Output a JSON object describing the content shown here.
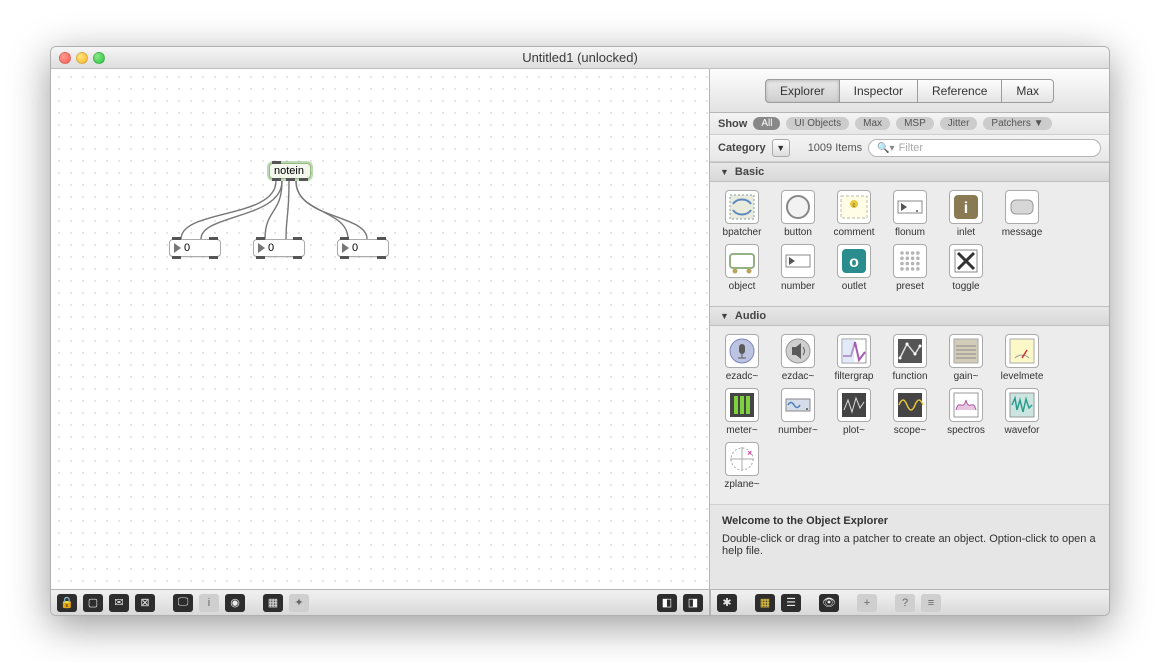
{
  "window": {
    "title": "Untitled1 (unlocked)"
  },
  "patcher": {
    "notein_label": "notein",
    "num1": "0",
    "num2": "0",
    "num3": "0"
  },
  "tabs": {
    "explorer": "Explorer",
    "inspector": "Inspector",
    "reference": "Reference",
    "max": "Max"
  },
  "filters": {
    "show_label": "Show",
    "all": "All",
    "ui_objects": "UI Objects",
    "max": "Max",
    "msp": "MSP",
    "jitter": "Jitter",
    "patchers": "Patchers ▼",
    "category_label": "Category",
    "item_count": "1009 Items",
    "search_placeholder": "Filter"
  },
  "sections": {
    "basic": "Basic",
    "audio": "Audio"
  },
  "basic_items": [
    {
      "name": "bpatcher",
      "icon": "bpatcher"
    },
    {
      "name": "button",
      "icon": "button"
    },
    {
      "name": "comment",
      "icon": "comment"
    },
    {
      "name": "flonum",
      "icon": "flonum"
    },
    {
      "name": "inlet",
      "icon": "inlet"
    },
    {
      "name": "message",
      "icon": "message"
    },
    {
      "name": "object",
      "icon": "object"
    },
    {
      "name": "number",
      "icon": "number"
    },
    {
      "name": "outlet",
      "icon": "outlet"
    },
    {
      "name": "preset",
      "icon": "preset"
    },
    {
      "name": "toggle",
      "icon": "toggle"
    }
  ],
  "audio_items": [
    {
      "name": "ezadc~",
      "icon": "ezadc"
    },
    {
      "name": "ezdac~",
      "icon": "ezdac"
    },
    {
      "name": "filtergrap",
      "icon": "filtergraph"
    },
    {
      "name": "function",
      "icon": "function"
    },
    {
      "name": "gain~",
      "icon": "gain"
    },
    {
      "name": "levelmete",
      "icon": "levelmeter"
    },
    {
      "name": "meter~",
      "icon": "meter"
    },
    {
      "name": "number~",
      "icon": "numbersig"
    },
    {
      "name": "plot~",
      "icon": "plot"
    },
    {
      "name": "scope~",
      "icon": "scope"
    },
    {
      "name": "spectros",
      "icon": "spectro"
    },
    {
      "name": "wavefor",
      "icon": "waveform"
    },
    {
      "name": "zplane~",
      "icon": "zplane"
    }
  ],
  "welcome": {
    "heading": "Welcome to the Object Explorer",
    "body": "Double-click or drag into a patcher to create an object. Option-click to open a help file."
  }
}
